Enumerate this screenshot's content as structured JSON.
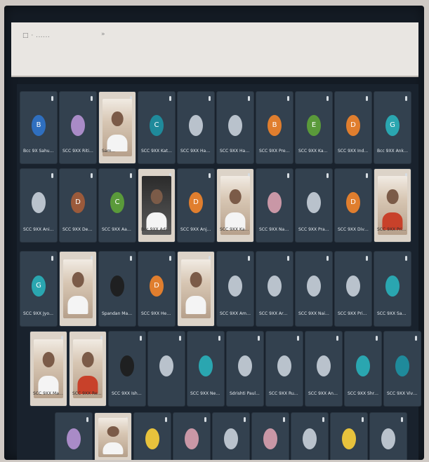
{
  "topbar": {
    "crumb": "□ · ......",
    "mini": "»"
  },
  "colors": {
    "blue": "#2f6fbf",
    "purple": "#a98bc7",
    "teal": "#1f8a9b",
    "orange": "#e07e2e",
    "green": "#5a9a3a",
    "gray": "#b9c2cc",
    "cyan": "#2aa6b0",
    "brown": "#9b5a3b",
    "dark": "#1f2021",
    "yellow": "#e7c23c",
    "pink": "#c997a6"
  },
  "rows": [
    {
      "tiles": [
        {
          "avatar": "B",
          "color": "blue",
          "name": "Bcc 9X Sahu (...",
          "video": false
        },
        {
          "avatar": "",
          "color": "purple",
          "name": "SCC 9XX Ritika",
          "video": false
        },
        {
          "avatar": "",
          "color": "gray",
          "name": "Sam...",
          "video": true
        },
        {
          "avatar": "C",
          "color": "teal",
          "name": "SCC 9XX Katha",
          "video": false
        },
        {
          "avatar": "",
          "color": "gray",
          "name": "SCC 9XX Harsh...",
          "video": false
        },
        {
          "avatar": "",
          "color": "gray",
          "name": "SCC 9XX Harsh",
          "video": false
        },
        {
          "avatar": "B",
          "color": "orange",
          "name": "SCC 9XX Preeti",
          "video": false
        },
        {
          "avatar": "E",
          "color": "green",
          "name": "SCC 9XX Kavita...",
          "video": false
        },
        {
          "avatar": "D",
          "color": "orange",
          "name": "SCC 9XX Ind...",
          "video": false
        },
        {
          "avatar": "G",
          "color": "cyan",
          "name": "Bcc 9XX Ankita",
          "video": false
        }
      ]
    },
    {
      "tiles": [
        {
          "avatar": "",
          "color": "gray",
          "name": "SCC 9XX Anisha...",
          "video": false
        },
        {
          "avatar": "D",
          "color": "brown",
          "name": "SCC 9XX Devansh",
          "video": false
        },
        {
          "avatar": "C",
          "color": "green",
          "name": "SCC 9XX Aaryan...",
          "video": false
        },
        {
          "avatar": "",
          "color": "gray",
          "name": "Bcc 9XX Aditya...",
          "video": true,
          "style": "dark"
        },
        {
          "avatar": "D",
          "color": "orange",
          "name": "SCC 9XX Anjali",
          "video": false
        },
        {
          "avatar": "",
          "color": "gray",
          "name": "SCC 9XX Kavya",
          "video": true
        },
        {
          "avatar": "",
          "color": "pink",
          "name": "SCC 9XX Naman...",
          "video": false
        },
        {
          "avatar": "",
          "color": "gray",
          "name": "SCC 9XX Pranav...",
          "video": false
        },
        {
          "avatar": "D",
          "color": "orange",
          "name": "SCC 9XX Divya...",
          "video": false
        },
        {
          "avatar": "",
          "color": "gray",
          "name": "SCC 9XX Prince",
          "video": true,
          "style": "red"
        }
      ]
    },
    {
      "tiles": [
        {
          "avatar": "G",
          "color": "cyan",
          "name": "SCC 9XX Jyothi",
          "video": false
        },
        {
          "avatar": "",
          "color": "gray",
          "name": "",
          "video": true
        },
        {
          "avatar": "",
          "color": "dark",
          "name": "Spandan Mahto...",
          "video": false
        },
        {
          "avatar": "D",
          "color": "orange",
          "name": "SCC 9XX Hemant...",
          "video": false
        },
        {
          "avatar": "",
          "color": "gray",
          "name": "",
          "video": true
        },
        {
          "avatar": "",
          "color": "gray",
          "name": "SCC 9XX Amit...",
          "video": false
        },
        {
          "avatar": "",
          "color": "gray",
          "name": "SCC 9XX Arya...",
          "video": false
        },
        {
          "avatar": "",
          "color": "gray",
          "name": "SCC 9XX Naina...",
          "video": false
        },
        {
          "avatar": "",
          "color": "gray",
          "name": "SCC 9XX Priya...",
          "video": false
        },
        {
          "avatar": "",
          "color": "cyan",
          "name": "SCC 9XX Sakshi...",
          "video": false
        }
      ]
    },
    {
      "tiles": [
        {
          "avatar": "",
          "color": "gray",
          "name": "SCC 9XX Manas",
          "video": true
        },
        {
          "avatar": "",
          "color": "gray",
          "name": "SCC 9XX Reena",
          "video": true,
          "style": "red"
        },
        {
          "avatar": "",
          "color": "dark",
          "name": "SCC 9XX Ishaan",
          "video": false
        },
        {
          "avatar": "",
          "color": "gray",
          "name": "",
          "video": false
        },
        {
          "avatar": "",
          "color": "cyan",
          "name": "SCC 9XX Neha...",
          "video": false
        },
        {
          "avatar": "",
          "color": "gray",
          "name": "Sdrishti Paul...",
          "video": false
        },
        {
          "avatar": "",
          "color": "gray",
          "name": "SCC 9XX Ruhi...",
          "video": false
        },
        {
          "avatar": "",
          "color": "gray",
          "name": "SCC 9XX Ankit...",
          "video": false
        },
        {
          "avatar": "",
          "color": "cyan",
          "name": "SCC 9XX Shreya...",
          "video": false
        },
        {
          "avatar": "",
          "color": "teal",
          "name": "SCC 9XX Vivek",
          "video": false
        }
      ]
    },
    {
      "tiles": [
        {
          "avatar": "",
          "color": "purple",
          "name": "",
          "video": false
        },
        {
          "avatar": "",
          "color": "gray",
          "name": "",
          "video": true
        },
        {
          "avatar": "",
          "color": "yellow",
          "name": "",
          "video": false
        },
        {
          "avatar": "",
          "color": "pink",
          "name": "",
          "video": false
        },
        {
          "avatar": "",
          "color": "gray",
          "name": "",
          "video": false
        },
        {
          "avatar": "",
          "color": "pink",
          "name": "",
          "video": false
        },
        {
          "avatar": "",
          "color": "gray",
          "name": "",
          "video": false
        },
        {
          "avatar": "",
          "color": "yellow",
          "name": "",
          "video": false
        },
        {
          "avatar": "",
          "color": "gray",
          "name": "",
          "video": false
        }
      ]
    }
  ]
}
